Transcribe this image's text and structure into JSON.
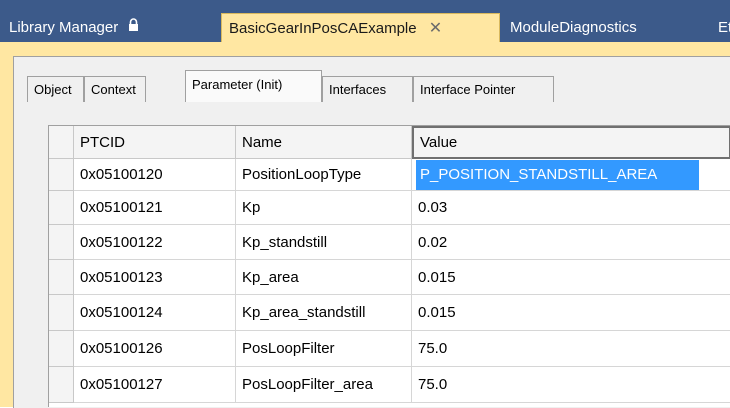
{
  "doc_tabs": {
    "library_manager": "Library Manager",
    "active": "BasicGearInPosCAExample",
    "module_diagnostics": "ModuleDiagnostics",
    "overflow": "Et"
  },
  "inner_tabs": {
    "object": "Object",
    "context": "Context",
    "parameter_init": "Parameter (Init)",
    "interfaces": "Interfaces",
    "interface_pointer": "Interface Pointer"
  },
  "table": {
    "columns": [
      "PTCID",
      "Name",
      "Value"
    ],
    "rows": [
      {
        "ptcid": "0x05100120",
        "name": "PositionLoopType",
        "value": "P_POSITION_STANDSTILL_AREA"
      },
      {
        "ptcid": "0x05100121",
        "name": "Kp",
        "value": "0.03"
      },
      {
        "ptcid": "0x05100122",
        "name": "Kp_standstill",
        "value": "0.02"
      },
      {
        "ptcid": "0x05100123",
        "name": "Kp_area",
        "value": "0.015"
      },
      {
        "ptcid": "0x05100124",
        "name": "Kp_area_standstill",
        "value": "0.015"
      },
      {
        "ptcid": "0x05100126",
        "name": "PosLoopFilter",
        "value": "75.0"
      },
      {
        "ptcid": "0x05100127",
        "name": "PosLoopFilter_area",
        "value": "75.0"
      }
    ],
    "selected_row": 0
  },
  "colors": {
    "tab_strip": "#3c5a8a",
    "active_tab": "#ffe7a2",
    "selection": "#3399ff"
  }
}
